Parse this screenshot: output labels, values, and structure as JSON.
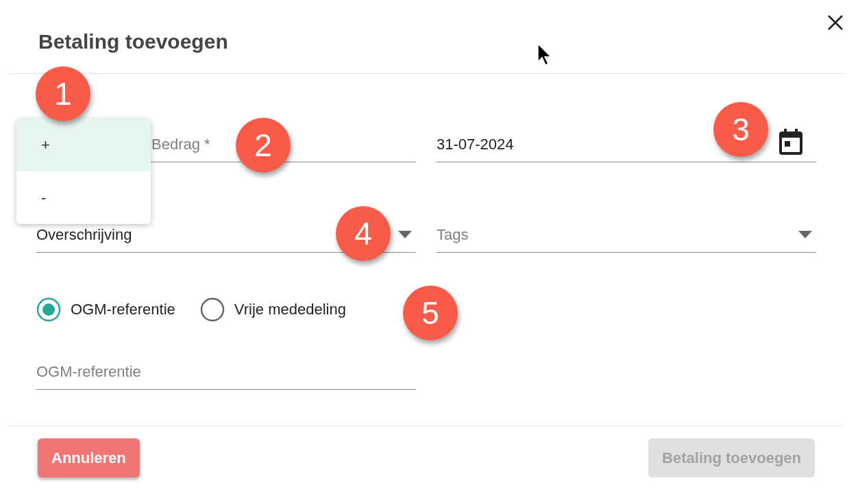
{
  "dialog": {
    "title": "Betaling toevoegen"
  },
  "sign_menu": {
    "options": [
      {
        "label": "+",
        "selected": true
      },
      {
        "label": "-",
        "selected": false
      }
    ]
  },
  "fields": [
    {
      "kind": "text",
      "placeholder": "Bedrag *"
    },
    {
      "kind": "date",
      "value": "31-07-2024"
    },
    {
      "kind": "select",
      "value": "Overschrijving"
    },
    {
      "kind": "select",
      "placeholder": "Tags"
    }
  ],
  "radios": [
    {
      "label": "OGM-referentie",
      "selected": true
    },
    {
      "label": "Vrije mededeling",
      "selected": false
    }
  ],
  "reference_field": {
    "placeholder": "OGM-referentie"
  },
  "buttons": [
    {
      "label": "Annuleren",
      "kind": "cancel",
      "disabled": false
    },
    {
      "label": "Betaling toevoegen",
      "kind": "primary",
      "disabled": true
    }
  ],
  "annotations": [
    {
      "label": "1"
    },
    {
      "label": "2"
    },
    {
      "label": "3"
    },
    {
      "label": "4"
    },
    {
      "label": "5"
    }
  ]
}
